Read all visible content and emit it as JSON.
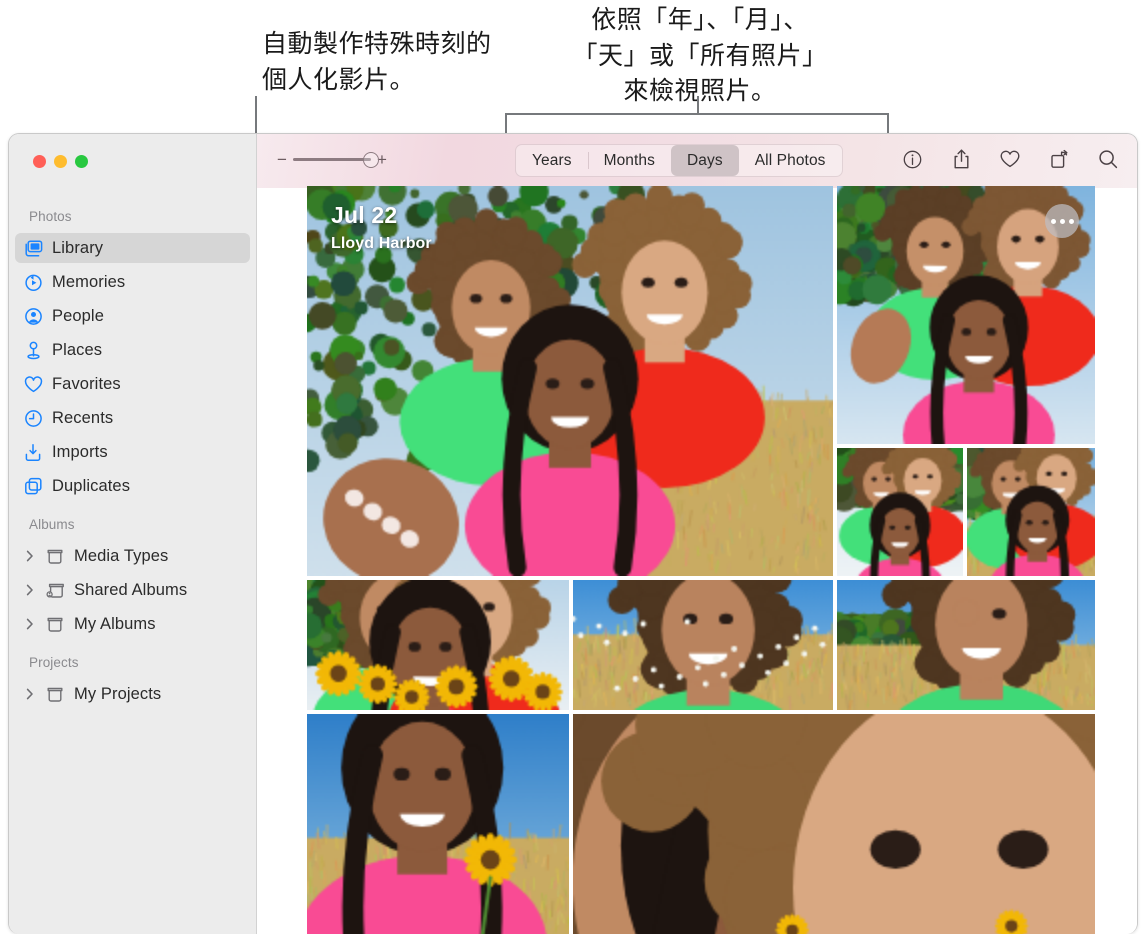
{
  "callouts": {
    "left": {
      "text": "自動製作特殊時刻的\n個人化影片。",
      "target": "sidebar-item-library"
    },
    "right": {
      "text": "依照「年」、「月」、\n「天」或「所有照片」\n來檢視照片。",
      "target": "view-mode-segmented-control"
    }
  },
  "window": {
    "traffic_lights": [
      {
        "name": "close",
        "color": "#ff5f57"
      },
      {
        "name": "minimize",
        "color": "#febc2e"
      },
      {
        "name": "maximize",
        "color": "#28c840"
      }
    ]
  },
  "toolbar": {
    "zoom_slider": {
      "minus_label": "−",
      "plus_label": "+",
      "value": 100
    },
    "segments": [
      {
        "label": "Years",
        "selected": false
      },
      {
        "label": "Months",
        "selected": false
      },
      {
        "label": "Days",
        "selected": true
      },
      {
        "label": "All Photos",
        "selected": false
      }
    ],
    "icons": [
      {
        "name": "info-icon",
        "glyph": "info"
      },
      {
        "name": "share-icon",
        "glyph": "share"
      },
      {
        "name": "heart-icon",
        "glyph": "heart"
      },
      {
        "name": "rotate-icon",
        "glyph": "rotate"
      },
      {
        "name": "search-icon",
        "glyph": "search"
      }
    ]
  },
  "sidebar": {
    "groups": [
      {
        "title": "Photos",
        "items": [
          {
            "label": "Library",
            "icon": "library-icon",
            "selected": true,
            "disclosure": false
          },
          {
            "label": "Memories",
            "icon": "memories-icon",
            "selected": false,
            "disclosure": false
          },
          {
            "label": "People",
            "icon": "people-icon",
            "selected": false,
            "disclosure": false
          },
          {
            "label": "Places",
            "icon": "places-icon",
            "selected": false,
            "disclosure": false
          },
          {
            "label": "Favorites",
            "icon": "heart-icon",
            "selected": false,
            "disclosure": false
          },
          {
            "label": "Recents",
            "icon": "clock-icon",
            "selected": false,
            "disclosure": false
          },
          {
            "label": "Imports",
            "icon": "import-icon",
            "selected": false,
            "disclosure": false
          },
          {
            "label": "Duplicates",
            "icon": "duplicates-icon",
            "selected": false,
            "disclosure": false
          }
        ]
      },
      {
        "title": "Albums",
        "items": [
          {
            "label": "Media Types",
            "icon": "album-icon",
            "selected": false,
            "disclosure": true
          },
          {
            "label": "Shared Albums",
            "icon": "shared-album-icon",
            "selected": false,
            "disclosure": true
          },
          {
            "label": "My Albums",
            "icon": "album-icon",
            "selected": false,
            "disclosure": true
          }
        ]
      },
      {
        "title": "Projects",
        "items": [
          {
            "label": "My Projects",
            "icon": "album-icon",
            "selected": false,
            "disclosure": true
          }
        ]
      }
    ]
  },
  "grid": {
    "day_header": {
      "date": "Jul 22",
      "place": "Lloyd Harbor"
    },
    "more_button_label": "•••",
    "photos": [
      {
        "name": "hero-photo",
        "subject": "three women smiling outdoors, trees and sky"
      },
      {
        "name": "photo-2",
        "subject": "three women selfie, green and red tops"
      },
      {
        "name": "photo-3",
        "subject": "two women cheek to cheek, green top"
      },
      {
        "name": "photo-4",
        "subject": "three women in field, braids and pink top"
      },
      {
        "name": "photo-5",
        "subject": "three women with sunflowers"
      },
      {
        "name": "photo-6",
        "subject": "woman in green top in tall grass"
      },
      {
        "name": "photo-7",
        "subject": "woman in green top hand on forehead, dry field"
      },
      {
        "name": "photo-8",
        "subject": "woman in pink holding sunflower"
      },
      {
        "name": "photo-9",
        "subject": "three women laughing under blue sky"
      }
    ]
  }
}
